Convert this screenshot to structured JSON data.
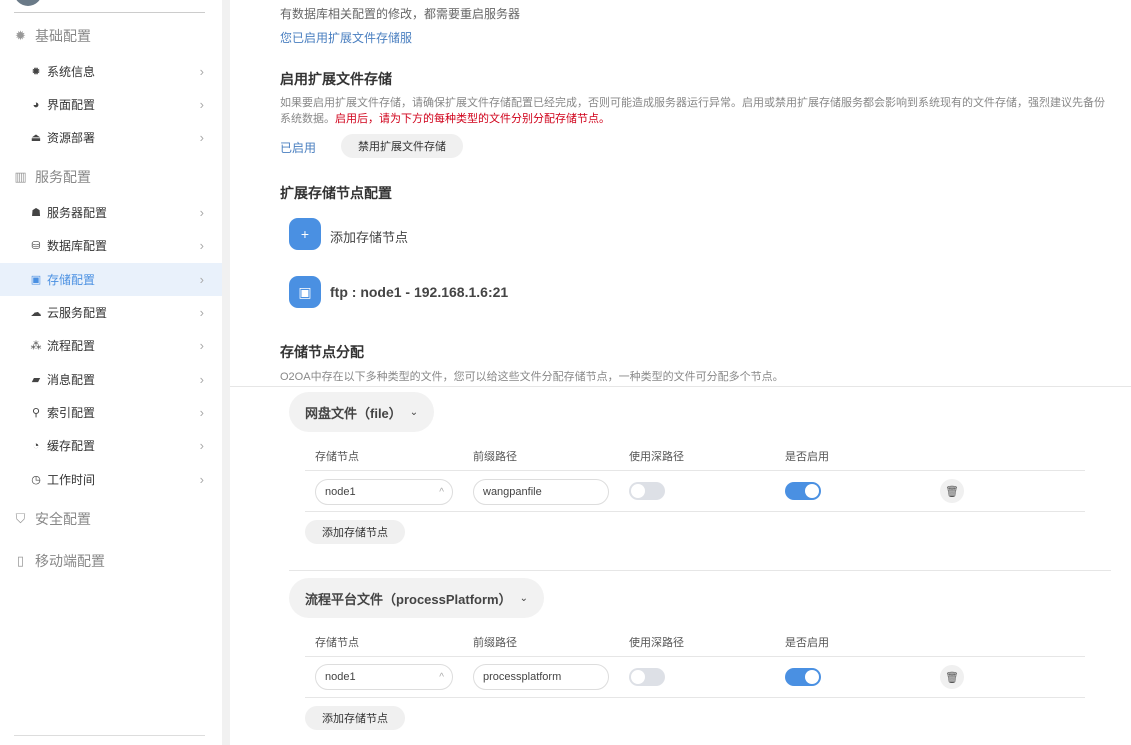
{
  "sidebar": {
    "sections": [
      {
        "label": "基础配置",
        "icon": "gear-icon",
        "items": [
          {
            "label": "系统信息",
            "icon": "gear-icon"
          },
          {
            "label": "界面配置",
            "icon": "palette-icon"
          },
          {
            "label": "资源部署",
            "icon": "deploy-icon"
          }
        ]
      },
      {
        "label": "服务配置",
        "icon": "server-icon",
        "items": [
          {
            "label": "服务器配置",
            "icon": "server-user-icon"
          },
          {
            "label": "数据库配置",
            "icon": "database-icon"
          },
          {
            "label": "存储配置",
            "icon": "storage-icon",
            "active": true
          },
          {
            "label": "云服务配置",
            "icon": "cloud-icon"
          },
          {
            "label": "流程配置",
            "icon": "flow-icon"
          },
          {
            "label": "消息配置",
            "icon": "message-icon"
          },
          {
            "label": "索引配置",
            "icon": "search-icon"
          },
          {
            "label": "缓存配置",
            "icon": "pie-icon"
          },
          {
            "label": "工作时间",
            "icon": "timer-icon"
          }
        ]
      },
      {
        "label": "安全配置",
        "icon": "shield-icon",
        "items": []
      },
      {
        "label": "移动端配置",
        "icon": "mobile-icon",
        "items": []
      }
    ]
  },
  "main": {
    "intro_tail": "有数据库相关配置的修改，都需要重启服务器",
    "enabled_notice": "您已启用扩展文件存储服",
    "enable_title": "启用扩展文件存储",
    "enable_desc": "如果要启用扩展文件存储，请确保扩展文件存储配置已经完成，否则可能造成服务器运行异常。启用或禁用扩展存储服务都会影响到系统现有的文件存储，强烈建议先备份系统数据。",
    "enable_warning": "启用后，请为下方的每种类型的文件分别分配存储节点。",
    "status": "已启用",
    "disable_button": "禁用扩展文件存储",
    "nodes_title": "扩展存储节点配置",
    "add_node": "添加存储节点",
    "node": "ftp : node1 - 192.168.1.6:21",
    "assign_title": "存储节点分配",
    "assign_desc": "O2OA中存在以下多种类型的文件，您可以给这些文件分配存储节点，一种类型的文件可分配多个节点。",
    "columns": [
      "存储节点",
      "前缀路径",
      "使用深路径",
      "是否启用"
    ],
    "add_row_button": "添加存储节点",
    "file_types": [
      {
        "label": "网盘文件（file）",
        "rows": [
          {
            "node": "node1",
            "prefix": "wangpanfile",
            "deep": false,
            "enabled": true
          }
        ]
      },
      {
        "label": "流程平台文件（processPlatform）",
        "rows": [
          {
            "node": "node1",
            "prefix": "processplatform",
            "deep": false,
            "enabled": true
          }
        ]
      }
    ]
  },
  "colors": {
    "accent": "#4a90e2",
    "warning": "#d0021b",
    "active_bg": "#e9f1fb"
  }
}
